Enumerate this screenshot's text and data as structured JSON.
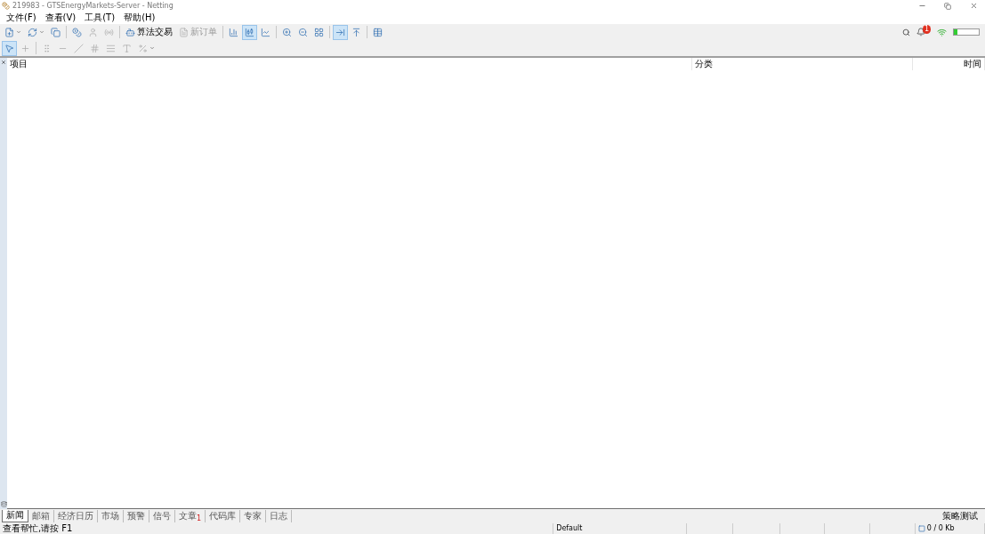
{
  "window": {
    "title": "219983 - GTSEnergyMarkets-Server - Netting"
  },
  "menu": [
    "文件(F)",
    "查看(V)",
    "工具(T)",
    "帮助(H)"
  ],
  "toolbar": [
    {
      "kind": "dropdown",
      "pressed": false,
      "disabled": false
    },
    {
      "kind": "dropdown",
      "pressed": false,
      "disabled": false
    },
    {
      "kind": "icon",
      "pressed": false,
      "disabled": false
    },
    {
      "kind": "separator"
    },
    {
      "kind": "icon",
      "pressed": false,
      "disabled": false
    },
    {
      "kind": "icon",
      "pressed": false,
      "disabled": true
    },
    {
      "kind": "icon",
      "pressed": false,
      "disabled": true
    },
    {
      "kind": "separator"
    },
    {
      "kind": "labeled",
      "label": "算法交易",
      "pressed": false,
      "disabled": false
    },
    {
      "kind": "labeled",
      "label": "新订单",
      "pressed": false,
      "disabled": true
    },
    {
      "kind": "separator"
    },
    {
      "kind": "icon",
      "pressed": false,
      "disabled": false
    },
    {
      "kind": "icon",
      "pressed": true,
      "disabled": false
    },
    {
      "kind": "icon",
      "pressed": false,
      "disabled": false
    },
    {
      "kind": "separator"
    },
    {
      "kind": "icon",
      "pressed": false,
      "disabled": false
    },
    {
      "kind": "icon",
      "pressed": false,
      "disabled": false
    },
    {
      "kind": "icon",
      "pressed": false,
      "disabled": false
    },
    {
      "kind": "separator"
    },
    {
      "kind": "icon",
      "pressed": true,
      "disabled": false
    },
    {
      "kind": "icon",
      "pressed": false,
      "disabled": false
    },
    {
      "kind": "separator"
    },
    {
      "kind": "icon",
      "pressed": false,
      "disabled": false
    }
  ],
  "drawing_toolbar": [
    {
      "kind": "icon",
      "pressed": true,
      "disabled": false
    },
    {
      "kind": "icon",
      "pressed": false,
      "disabled": true
    },
    {
      "kind": "separator"
    },
    {
      "kind": "icon",
      "pressed": false,
      "disabled": true
    },
    {
      "kind": "icon",
      "pressed": false,
      "disabled": true
    },
    {
      "kind": "icon",
      "pressed": false,
      "disabled": true
    },
    {
      "kind": "icon",
      "pressed": false,
      "disabled": true
    },
    {
      "kind": "icon",
      "pressed": false,
      "disabled": true
    },
    {
      "kind": "icon",
      "pressed": false,
      "disabled": true
    },
    {
      "kind": "dropdown",
      "pressed": false,
      "disabled": true
    }
  ],
  "notifications": {
    "badge": "1"
  },
  "table": {
    "columns": [
      "项目",
      "分类",
      "时间"
    ]
  },
  "tabs": [
    {
      "label": "新闻",
      "selected": true
    },
    {
      "label": "邮箱",
      "selected": false
    },
    {
      "label": "经济日历",
      "selected": false
    },
    {
      "label": "市场",
      "selected": false
    },
    {
      "label": "预警",
      "selected": false
    },
    {
      "label": "信号",
      "selected": false
    },
    {
      "label": "文章",
      "selected": false,
      "badge": "1"
    },
    {
      "label": "代码库",
      "selected": false
    },
    {
      "label": "专家",
      "selected": false
    },
    {
      "label": "日志",
      "selected": false
    }
  ],
  "strategy_tester": "策略测试",
  "status_bar": {
    "help": "查看帮忙,请按 F1",
    "profile": "Default",
    "traffic": "0 / 0 Kb"
  }
}
